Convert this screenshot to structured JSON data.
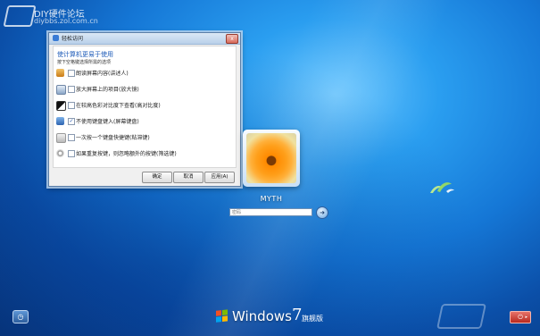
{
  "watermark": {
    "title": "DIY硬件论坛",
    "url": "diybbs.zol.com.cn"
  },
  "dialog": {
    "title": "轻松访问",
    "close_label": "x",
    "heading": "使计算机更易于使用",
    "subheading": "按下空格键选择所需的选项",
    "options": [
      {
        "label": "朗读屏幕内容(讲述人)",
        "checked": false,
        "checkmark": ""
      },
      {
        "label": "放大屏幕上的项目(放大镜)",
        "checked": false,
        "checkmark": ""
      },
      {
        "label": "在较高色彩对比度下查看(高对比度)",
        "checked": false,
        "checkmark": ""
      },
      {
        "label": "不使用键盘键入(屏幕键盘)",
        "checked": true,
        "checkmark": "✓"
      },
      {
        "label": "一次按一个键盘快捷键(粘滞键)",
        "checked": false,
        "checkmark": ""
      },
      {
        "label": "如果重复按键，则忽略额外的按键(筛选键)",
        "checked": false,
        "checkmark": ""
      }
    ],
    "buttons": {
      "ok": "确定",
      "cancel": "取消",
      "apply": "应用(A)"
    }
  },
  "login": {
    "username": "MYTH",
    "password_placeholder": "密码",
    "submit_glyph": "➜"
  },
  "bottom": {
    "ease_of_access_glyph": "◷",
    "brand_name": "Windows",
    "brand_version": "7",
    "brand_edition": "旗舰版",
    "power_glyph": "⏻",
    "power_arrow": "▸"
  },
  "icons": {
    "window_flag_colors": [
      "#f25022",
      "#7fba00",
      "#00a4ef",
      "#ffb900"
    ]
  }
}
